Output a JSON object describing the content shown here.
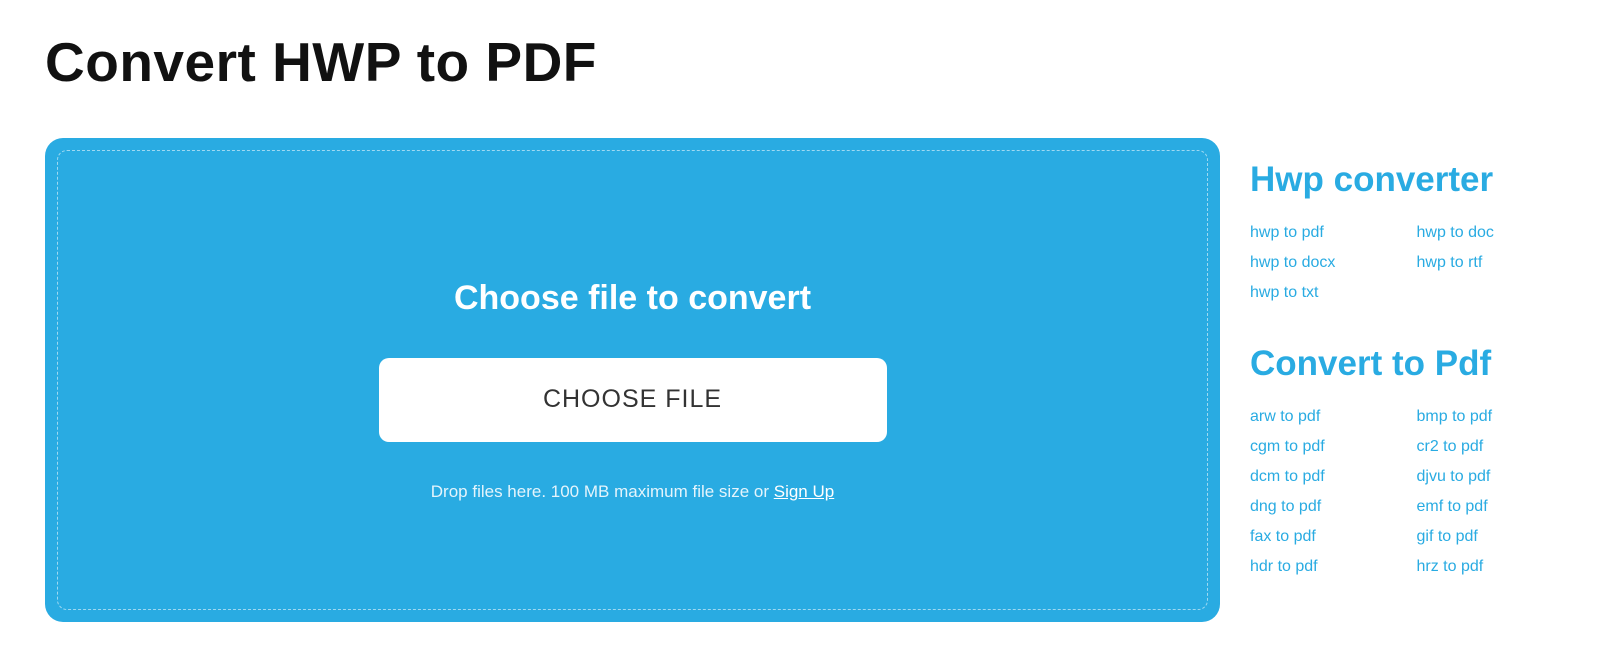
{
  "title": "Convert HWP to PDF",
  "upload": {
    "heading": "Choose file to convert",
    "button": "CHOOSE FILE",
    "hint_prefix": "Drop files here. 100 MB maximum file size or ",
    "signup": "Sign Up"
  },
  "sidebar": {
    "section1": {
      "title": "Hwp converter",
      "links": [
        "hwp to pdf",
        "hwp to doc",
        "hwp to docx",
        "hwp to rtf",
        "hwp to txt"
      ]
    },
    "section2": {
      "title": "Convert to Pdf",
      "links": [
        "arw to pdf",
        "bmp to pdf",
        "cgm to pdf",
        "cr2 to pdf",
        "dcm to pdf",
        "djvu to pdf",
        "dng to pdf",
        "emf to pdf",
        "fax to pdf",
        "gif to pdf",
        "hdr to pdf",
        "hrz to pdf"
      ]
    }
  }
}
